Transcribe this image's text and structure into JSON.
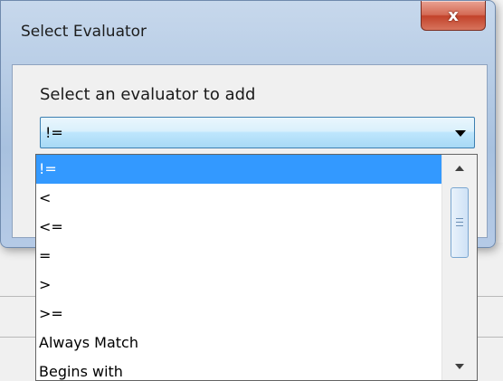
{
  "dialog": {
    "title": "Select Evaluator",
    "close_label": "x",
    "prompt": "Select an evaluator to add"
  },
  "combo": {
    "selected_value": "!="
  },
  "dropdown": {
    "items": [
      "!=",
      "<",
      "<=",
      "=",
      ">",
      ">=",
      "Always Match",
      "Begins with"
    ],
    "selected_index": 0
  },
  "colors": {
    "selection": "#3399ff",
    "close_button": "#c7503a",
    "dialog_frame": "#b5cae6"
  }
}
